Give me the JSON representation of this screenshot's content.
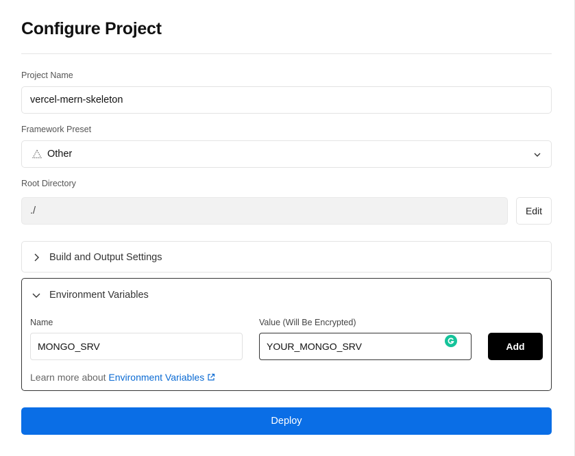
{
  "page": {
    "title": "Configure Project"
  },
  "project_name": {
    "label": "Project Name",
    "value": "vercel-mern-skeleton"
  },
  "framework_preset": {
    "label": "Framework Preset",
    "value": "Other",
    "icon": "framework-triangle-icon"
  },
  "root_directory": {
    "label": "Root Directory",
    "value": "./",
    "edit_label": "Edit"
  },
  "build_settings": {
    "label": "Build and Output Settings",
    "expanded": false
  },
  "env_vars": {
    "label": "Environment Variables",
    "expanded": true,
    "name_label": "Name",
    "value_label": "Value (Will Be Encrypted)",
    "name_value": "MONGO_SRV",
    "value_value": "YOUR_MONGO_SRV",
    "add_label": "Add",
    "learn_prefix": "Learn more about ",
    "learn_link": "Environment Variables"
  },
  "deploy": {
    "label": "Deploy"
  },
  "colors": {
    "deploy_bg": "#0a6ee6",
    "add_bg": "#000000",
    "link": "#0a6ad3",
    "grammarly": "#15c39a"
  }
}
